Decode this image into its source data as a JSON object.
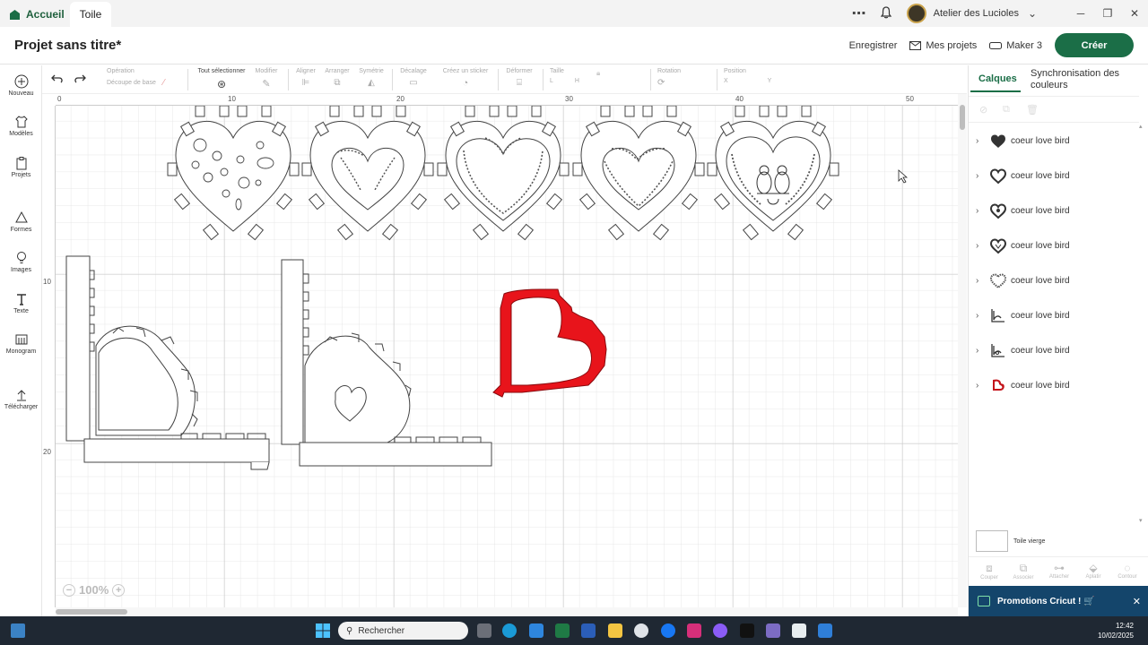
{
  "tabs": {
    "home": "Accueil",
    "canvas": "Toile"
  },
  "account": {
    "name": "Atelier des Lucioles"
  },
  "header": {
    "title": "Projet sans titre*",
    "save": "Enregistrer",
    "my_projects": "Mes projets",
    "machine": "Maker 3",
    "create": "Créer"
  },
  "sidebar": [
    {
      "label": "Nouveau",
      "icon": "plus-icon"
    },
    {
      "label": "Modèles",
      "icon": "shirt-icon"
    },
    {
      "label": "Projets",
      "icon": "clipboard-icon"
    },
    {
      "label": "Formes",
      "icon": "shapes-icon"
    },
    {
      "label": "Images",
      "icon": "lightbulb-icon"
    },
    {
      "label": "Texte",
      "icon": "text-icon"
    },
    {
      "label": "Monogram",
      "icon": "monogram-icon"
    },
    {
      "label": "Télécharger",
      "icon": "upload-icon"
    }
  ],
  "toolbar": {
    "operation": "Opération",
    "operation_value": "Découpe de base",
    "select_all": "Tout sélectionner",
    "edit": "Modifier",
    "align": "Aligner",
    "arrange": "Arranger",
    "symmetry": "Symétrie",
    "offset": "Décalage",
    "create_sticker": "Créez un sticker",
    "warp": "Déformer",
    "size": "Taille",
    "size_w": "L",
    "size_h": "H",
    "rotation": "Rotation",
    "position": "Position",
    "pos_x": "X",
    "pos_y": "Y"
  },
  "ruler": {
    "top": [
      "0",
      "10",
      "20",
      "30",
      "40",
      "50"
    ],
    "left": [
      "10",
      "20"
    ]
  },
  "zoom": "100%",
  "right_panel": {
    "tab_layers": "Calques",
    "tab_sync": "Synchronisation des couleurs",
    "layers": [
      {
        "name": "coeur love bird"
      },
      {
        "name": "coeur love bird"
      },
      {
        "name": "coeur love bird"
      },
      {
        "name": "coeur love bird"
      },
      {
        "name": "coeur love bird"
      },
      {
        "name": "coeur love bird"
      },
      {
        "name": "coeur love bird"
      },
      {
        "name": "coeur love bird"
      }
    ],
    "blank_canvas": "Toile vierge",
    "bottom_tools": [
      "Couper",
      "Associer",
      "Attacher",
      "Aplatir",
      "Contour"
    ]
  },
  "promo": "Promotions Cricut ! 🛒",
  "taskbar": {
    "search": "Rechercher",
    "time": "12:42",
    "date": "10/02/2025"
  },
  "colors": {
    "brand": "#1b6e47",
    "selection_red": "#e8141b",
    "promo_bg": "#14456b"
  }
}
